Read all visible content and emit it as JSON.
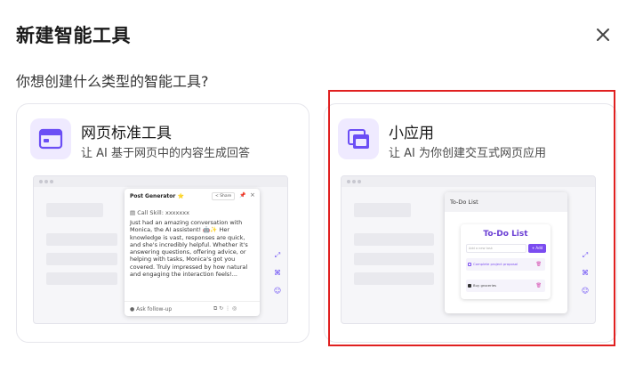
{
  "dialog": {
    "title": "新建智能工具",
    "subtitle": "你想创建什么类型的智能工具?"
  },
  "colors": {
    "accent": "#6b4ef5",
    "icon_bg": "#efeaff",
    "highlight_border": "#e02020"
  },
  "cards": [
    {
      "icon": "browser-window-icon",
      "title": "网页标准工具",
      "desc": "让 AI 基于网页中的内容生成回答",
      "preview": {
        "popup_title": "Post Generator",
        "popup_star": "⭐",
        "share_label": "< Share",
        "skill_label": "Call Skill: xxxxxxx",
        "body_text": "Just had an amazing conversation with Monica, the AI assistent! 🤖✨ Her knowledge is vast, responses are quick, and she's incredibly helpful. Whether it's answering questions, offering advice, or helping with tasks, Monica's got you covered. Truly impressed by how natural and engaging the interaction feels!...",
        "followup_label": "Ask follow-up"
      }
    },
    {
      "icon": "mini-app-icon",
      "title": "小应用",
      "desc": "让 AI 为你创建交互式网页应用",
      "preview": {
        "window_title": "To-Do List",
        "app_title": "To-Do List",
        "input_placeholder": "Add a new task",
        "add_label": "+ Add",
        "items": [
          "Complete project proposal",
          "Buy groceries"
        ]
      }
    }
  ]
}
